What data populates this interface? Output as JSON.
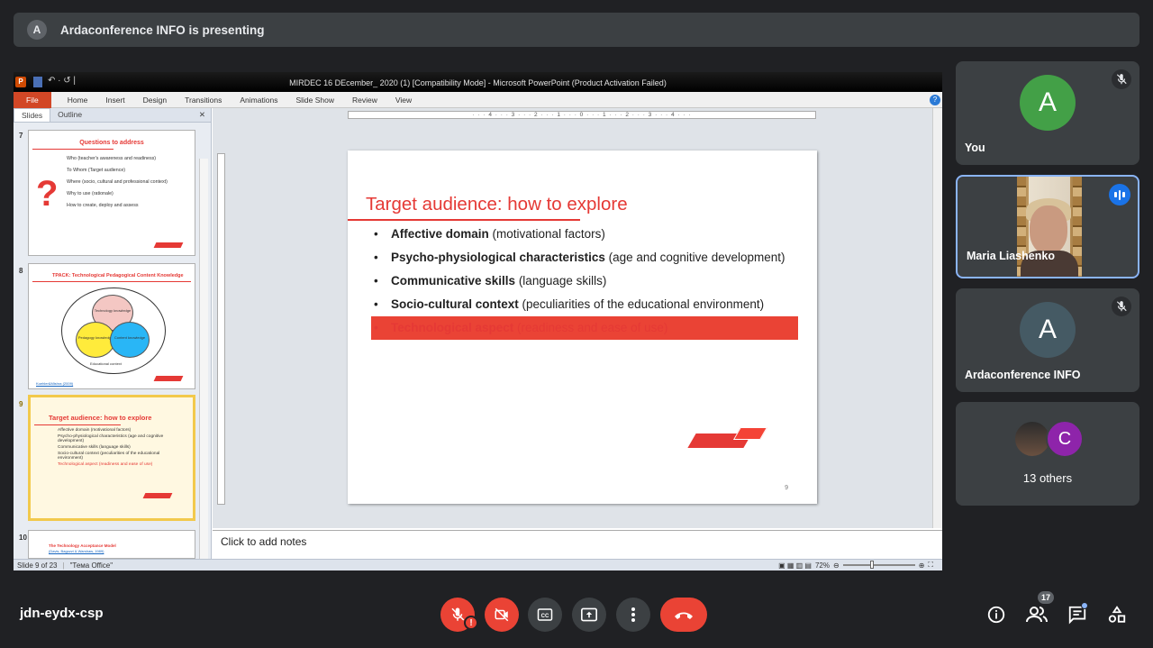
{
  "banner": {
    "avatar": "A",
    "text": "Ardaconference INFO is presenting"
  },
  "ppt": {
    "window_title": "MIRDEC 16 DEcember_ 2020 (1) [Compatibility Mode] - Microsoft PowerPoint (Product Activation Failed)",
    "ribbon_tabs": [
      "File",
      "Home",
      "Insert",
      "Design",
      "Transitions",
      "Animations",
      "Slide Show",
      "Review",
      "View"
    ],
    "panel_tabs": [
      "Slides",
      "Outline"
    ],
    "thumbs": [
      {
        "num": "7",
        "title": "Questions to address",
        "q": "?",
        "items": [
          "Who (teacher's awareness and readiness)",
          "To Whom (Target audience)",
          "Where (socio, cultural and professional context)",
          "Why to use (rationale)",
          "How to create, deploy and assess"
        ]
      },
      {
        "num": "8",
        "title": "TPACK: Technological Pedagogical Content Knowledge",
        "c1": "Technology knowledge",
        "c2": "Pedagogy knowledge",
        "c3": "Content knowledge",
        "ctx": "Educational context",
        "cite": "Koehler&Mishra (2009)"
      },
      {
        "num": "9",
        "title": "Target audience: how to explore",
        "items": [
          "Affective domain (motivational factors)",
          "Psycho-physiological characteristics (age and cognitive development)",
          "Communicative skills (language skills)",
          "Socio-cultural context (peculiarities of the educational environment)",
          "Technological aspect (readiness and ease of use)"
        ]
      },
      {
        "num": "10",
        "title": "The Technology Acceptance Model",
        "sub": "(Davis, Bagozzi & Warshaw, 1989)"
      }
    ],
    "ruler": "· · · 4 · · · 3 · · · 2 · · · 1 · · · 0 · · · 1 · · · 2 · · · 3 · · · 4 · · ·",
    "slide": {
      "title": "Target audience: how to explore",
      "items": [
        {
          "bold": "Affective domain",
          "rest": " (motivational factors)"
        },
        {
          "bold": "Psycho-physiological characteristics",
          "rest": " (age and cognitive development)"
        },
        {
          "bold": "Communicative skills",
          "rest": " (language skills)"
        },
        {
          "bold": "Socio-cultural context",
          "rest": " (peculiarities of the educational environment)"
        },
        {
          "bold": "Technological aspect",
          "rest": " (readiness and ease of use)"
        }
      ],
      "number": "9"
    },
    "notes_placeholder": "Click to add notes",
    "status": {
      "slide": "Slide 9 of 23",
      "theme": "\"Тема Office\"",
      "zoom": "72%"
    }
  },
  "participants": [
    {
      "name": "You",
      "initial": "A",
      "color": "#43a047"
    },
    {
      "name": "Maria Liashenko"
    },
    {
      "name": "Ardaconference INFO",
      "initial": "A",
      "color": "#455a64"
    },
    {
      "label": "13 others",
      "initial": "C"
    }
  ],
  "meeting": {
    "code": "jdn-eydx-csp",
    "participant_count": "17"
  },
  "colors": {
    "accent": "#e53935",
    "end_call": "#ea4335",
    "meet_bg": "#202124",
    "tile_bg": "#3c4043"
  }
}
